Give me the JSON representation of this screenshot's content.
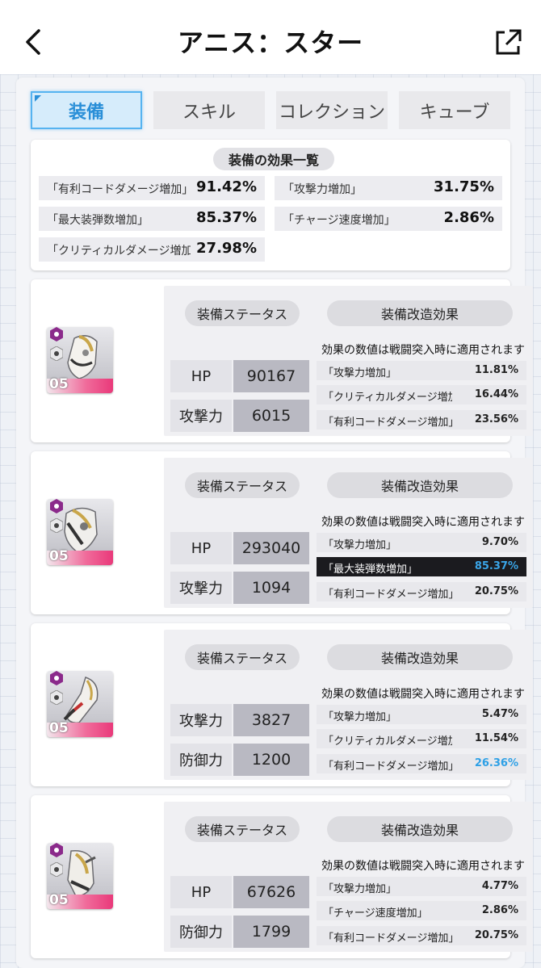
{
  "header": {
    "title": "アニス：スター"
  },
  "tabs": [
    {
      "label": "装備",
      "active": true
    },
    {
      "label": "スキル",
      "active": false
    },
    {
      "label": "コレクション",
      "active": false
    },
    {
      "label": "キューブ",
      "active": false
    }
  ],
  "summary": {
    "title": "装備の効果一覧",
    "items": [
      {
        "label": "「有利コードダメージ増加」",
        "value": "91.42%"
      },
      {
        "label": "「攻撃力増加」",
        "value": "31.75%"
      },
      {
        "label": "「最大装弾数増加」",
        "value": "85.37%"
      },
      {
        "label": "「チャージ速度増加」",
        "value": "2.86%"
      },
      {
        "label": "「クリティカルダメージ増加」",
        "value": "27.98%"
      }
    ]
  },
  "colors": {
    "accent": "#2a8fd8",
    "highlight_value": "#2ea0e6",
    "rarity_bar": "#e9397a"
  },
  "equipment": [
    {
      "level": "05",
      "status_title": "装備ステータス",
      "mod_title": "装備改造効果",
      "note": "効果の数値は戦闘突入時に適用されます",
      "stats": [
        {
          "label": "HP",
          "value": "90167"
        },
        {
          "label": "攻撃力",
          "value": "6015"
        }
      ],
      "effects": [
        {
          "label": "「攻撃力増加」",
          "value": "11.81%",
          "highlight": false,
          "blue": false
        },
        {
          "label": "「クリティカルダメージ増加」",
          "value": "16.44%",
          "highlight": false,
          "blue": false
        },
        {
          "label": "「有利コードダメージ増加」",
          "value": "23.56%",
          "highlight": false,
          "blue": false
        }
      ]
    },
    {
      "level": "05",
      "status_title": "装備ステータス",
      "mod_title": "装備改造効果",
      "note": "効果の数値は戦闘突入時に適用されます",
      "stats": [
        {
          "label": "HP",
          "value": "293040"
        },
        {
          "label": "攻撃力",
          "value": "1094"
        }
      ],
      "effects": [
        {
          "label": "「攻撃力増加」",
          "value": "9.70%",
          "highlight": false,
          "blue": false
        },
        {
          "label": "「最大装弾数増加」",
          "value": "85.37%",
          "highlight": true,
          "blue": true
        },
        {
          "label": "「有利コードダメージ増加」",
          "value": "20.75%",
          "highlight": false,
          "blue": false
        }
      ]
    },
    {
      "level": "05",
      "status_title": "装備ステータス",
      "mod_title": "装備改造効果",
      "note": "効果の数値は戦闘突入時に適用されます",
      "stats": [
        {
          "label": "攻撃力",
          "value": "3827"
        },
        {
          "label": "防御力",
          "value": "1200"
        }
      ],
      "effects": [
        {
          "label": "「攻撃力増加」",
          "value": "5.47%",
          "highlight": false,
          "blue": false
        },
        {
          "label": "「クリティカルダメージ増加」",
          "value": "11.54%",
          "highlight": false,
          "blue": false
        },
        {
          "label": "「有利コードダメージ増加」",
          "value": "26.36%",
          "highlight": false,
          "blue": true
        }
      ]
    },
    {
      "level": "05",
      "status_title": "装備ステータス",
      "mod_title": "装備改造効果",
      "note": "効果の数値は戦闘突入時に適用されます",
      "stats": [
        {
          "label": "HP",
          "value": "67626"
        },
        {
          "label": "防御力",
          "value": "1799"
        }
      ],
      "effects": [
        {
          "label": "「攻撃力増加」",
          "value": "4.77%",
          "highlight": false,
          "blue": false
        },
        {
          "label": "「チャージ速度増加」",
          "value": "2.86%",
          "highlight": false,
          "blue": false
        },
        {
          "label": "「有利コードダメージ増加」",
          "value": "20.75%",
          "highlight": false,
          "blue": false
        }
      ]
    }
  ]
}
